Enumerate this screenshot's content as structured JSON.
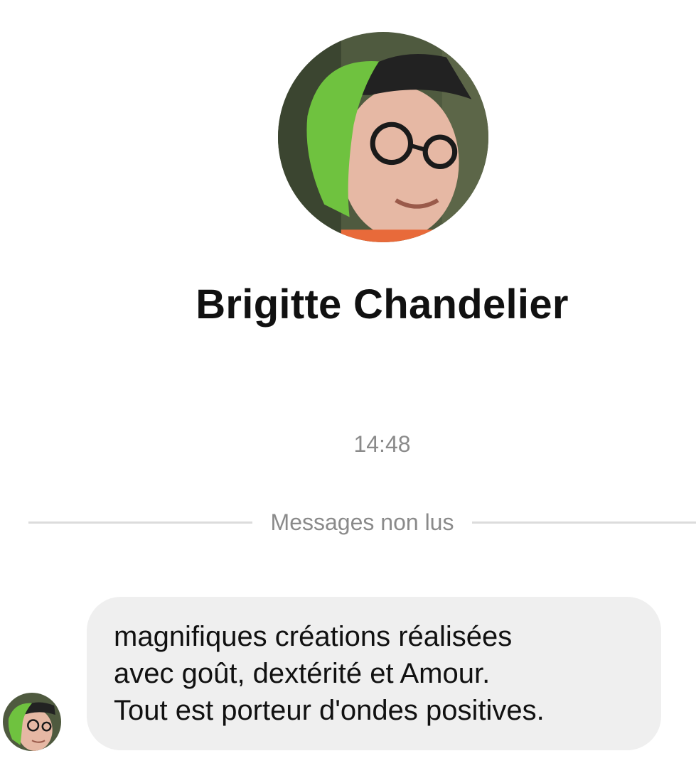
{
  "contact": {
    "name": "Brigitte Chandelier",
    "avatar_icon": "profile-photo"
  },
  "chat": {
    "timestamp": "14:48",
    "unread_divider_label": "Messages non lus",
    "messages": [
      {
        "sender": "Brigitte Chandelier",
        "lines": [
          "magnifiques créations réalisées",
          "avec goût, dextérité et Amour.",
          "Tout est porteur d'ondes positives."
        ]
      }
    ]
  },
  "colors": {
    "background": "#ffffff",
    "bubble": "#efefef",
    "meta_text": "#8a8a8a",
    "headband": "#6fc23f"
  }
}
